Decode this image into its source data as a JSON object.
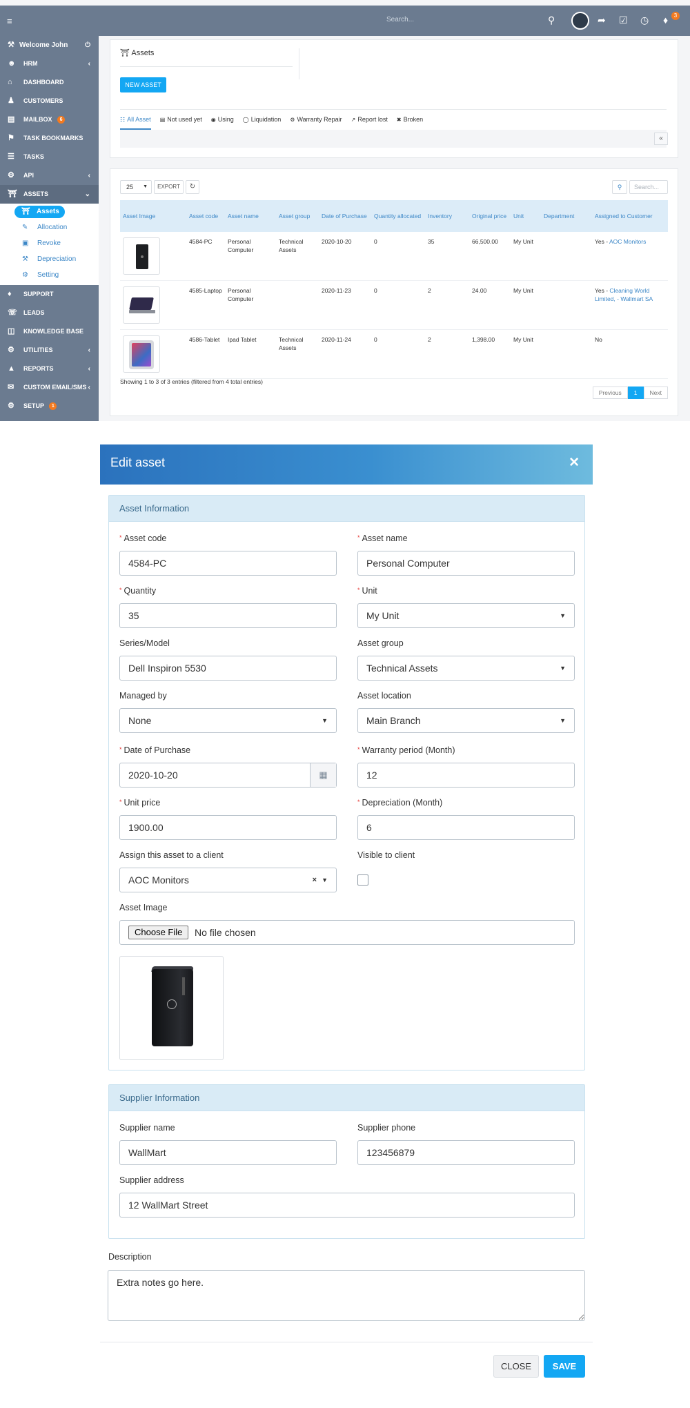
{
  "topbar": {
    "search_placeholder": "Search...",
    "notification_count": "3"
  },
  "sidebar": {
    "welcome": "Welcome John",
    "items": [
      {
        "label": "HRM",
        "icon": "user-circle-icon",
        "chevron": true
      },
      {
        "label": "DASHBOARD",
        "icon": "home-icon"
      },
      {
        "label": "CUSTOMERS",
        "icon": "user-icon"
      },
      {
        "label": "MAILBOX",
        "icon": "mailbox-icon",
        "badge": "6"
      },
      {
        "label": "TASK BOOKMARKS",
        "icon": "bookmark-icon"
      },
      {
        "label": "TASKS",
        "icon": "tasks-icon"
      },
      {
        "label": "API",
        "icon": "cogs-icon",
        "chevron": true
      },
      {
        "label": "ASSETS",
        "icon": "bank-icon",
        "chevron": true
      },
      {
        "label": "SUPPORT",
        "icon": "ticket-icon"
      },
      {
        "label": "LEADS",
        "icon": "tty-icon"
      },
      {
        "label": "KNOWLEDGE BASE",
        "icon": "folder-open-icon"
      },
      {
        "label": "UTILITIES",
        "icon": "cogs-icon",
        "chevron": true
      },
      {
        "label": "REPORTS",
        "icon": "area-chart-icon",
        "chevron": true
      },
      {
        "label": "CUSTOM EMAIL/SMS",
        "icon": "envelope-icon",
        "chevron": true
      },
      {
        "label": "SETUP",
        "icon": "cog-icon",
        "badge": "1"
      }
    ],
    "assets_sub": [
      "Assets",
      "Allocation",
      "Revoke",
      "Depreciation",
      "Setting"
    ]
  },
  "assets_panel": {
    "title": "Assets",
    "new_button": "NEW ASSET",
    "tabs": [
      "All Asset",
      "Not used yet",
      "Using",
      "Liquidation",
      "Warranty Repair",
      "Report lost",
      "Broken"
    ]
  },
  "table": {
    "page_length": "25",
    "export_label": "EXPORT",
    "search_placeholder": "Search...",
    "headers": [
      "Asset Image",
      "Asset code",
      "Asset name",
      "Asset group",
      "Date of Purchase",
      "Quantity allocated",
      "Inventory",
      "Original price",
      "Unit",
      "Department",
      "Assigned to Customer"
    ],
    "rows": [
      {
        "code": "4584-PC",
        "name": "Personal Computer",
        "group": "Technical Assets",
        "date": "2020-10-20",
        "allocated": "0",
        "inventory": "35",
        "price": "66,500.00",
        "unit": "My Unit",
        "department": "",
        "assigned_prefix": "Yes - ",
        "assigned": "AOC Monitors"
      },
      {
        "code": "4585-Laptop",
        "name": "Personal Computer",
        "group": "",
        "date": "2020-11-23",
        "allocated": "0",
        "inventory": "2",
        "price": "24.00",
        "unit": "My Unit",
        "department": "",
        "assigned_prefix": "Yes - ",
        "assigned": "Cleaning World Limited, - Wallmart SA"
      },
      {
        "code": "4586-Tablet",
        "name": "Ipad Tablet",
        "group": "Technical Assets",
        "date": "2020-11-24",
        "allocated": "0",
        "inventory": "2",
        "price": "1,398.00",
        "unit": "My Unit",
        "department": "",
        "assigned_prefix": "No",
        "assigned": ""
      }
    ],
    "info": "Showing 1 to 3 of 3 entries (filtered from 4 total entries)",
    "pager": {
      "previous": "Previous",
      "current": "1",
      "next": "Next"
    }
  },
  "modal": {
    "title": "Edit asset",
    "asset_section": "Asset Information",
    "fields": {
      "asset_code": {
        "label": "Asset code",
        "value": "4584-PC"
      },
      "asset_name": {
        "label": "Asset name",
        "value": "Personal Computer"
      },
      "quantity": {
        "label": "Quantity",
        "value": "35"
      },
      "unit": {
        "label": "Unit",
        "value": "My Unit"
      },
      "series_model": {
        "label": "Series/Model",
        "value": "Dell Inspiron 5530"
      },
      "asset_group": {
        "label": "Asset group",
        "value": "Technical Assets"
      },
      "managed_by": {
        "label": "Managed by",
        "value": "None"
      },
      "asset_location": {
        "label": "Asset location",
        "value": "Main Branch"
      },
      "date_of_purchase": {
        "label": "Date of Purchase",
        "value": "2020-10-20"
      },
      "warranty_period": {
        "label": "Warranty period (Month)",
        "value": "12"
      },
      "unit_price": {
        "label": "Unit price",
        "value": "1900.00"
      },
      "depreciation": {
        "label": "Depreciation (Month)",
        "value": "6"
      },
      "assign_client": {
        "label": "Assign this asset to a client",
        "value": "AOC Monitors"
      },
      "visible_to_client": {
        "label": "Visible to client",
        "checked": false
      },
      "asset_image": {
        "label": "Asset Image",
        "button": "Choose File",
        "status": "No file chosen"
      }
    },
    "supplier_section": "Supplier Information",
    "supplier": {
      "name": {
        "label": "Supplier name",
        "value": "WallMart"
      },
      "phone": {
        "label": "Supplier phone",
        "value": "123456879"
      },
      "address": {
        "label": "Supplier address",
        "value": "12 WallMart Street"
      }
    },
    "description": {
      "label": "Description",
      "value": "Extra notes go here."
    },
    "close_button": "CLOSE",
    "save_button": "SAVE"
  },
  "colors": {
    "sidebar_bg": "#6b7b90",
    "accent": "#13a7f3",
    "link": "#3c87c7",
    "badge": "#f47a1f",
    "modal_header_start": "#2b72bd",
    "modal_header_end": "#6ebbde"
  }
}
